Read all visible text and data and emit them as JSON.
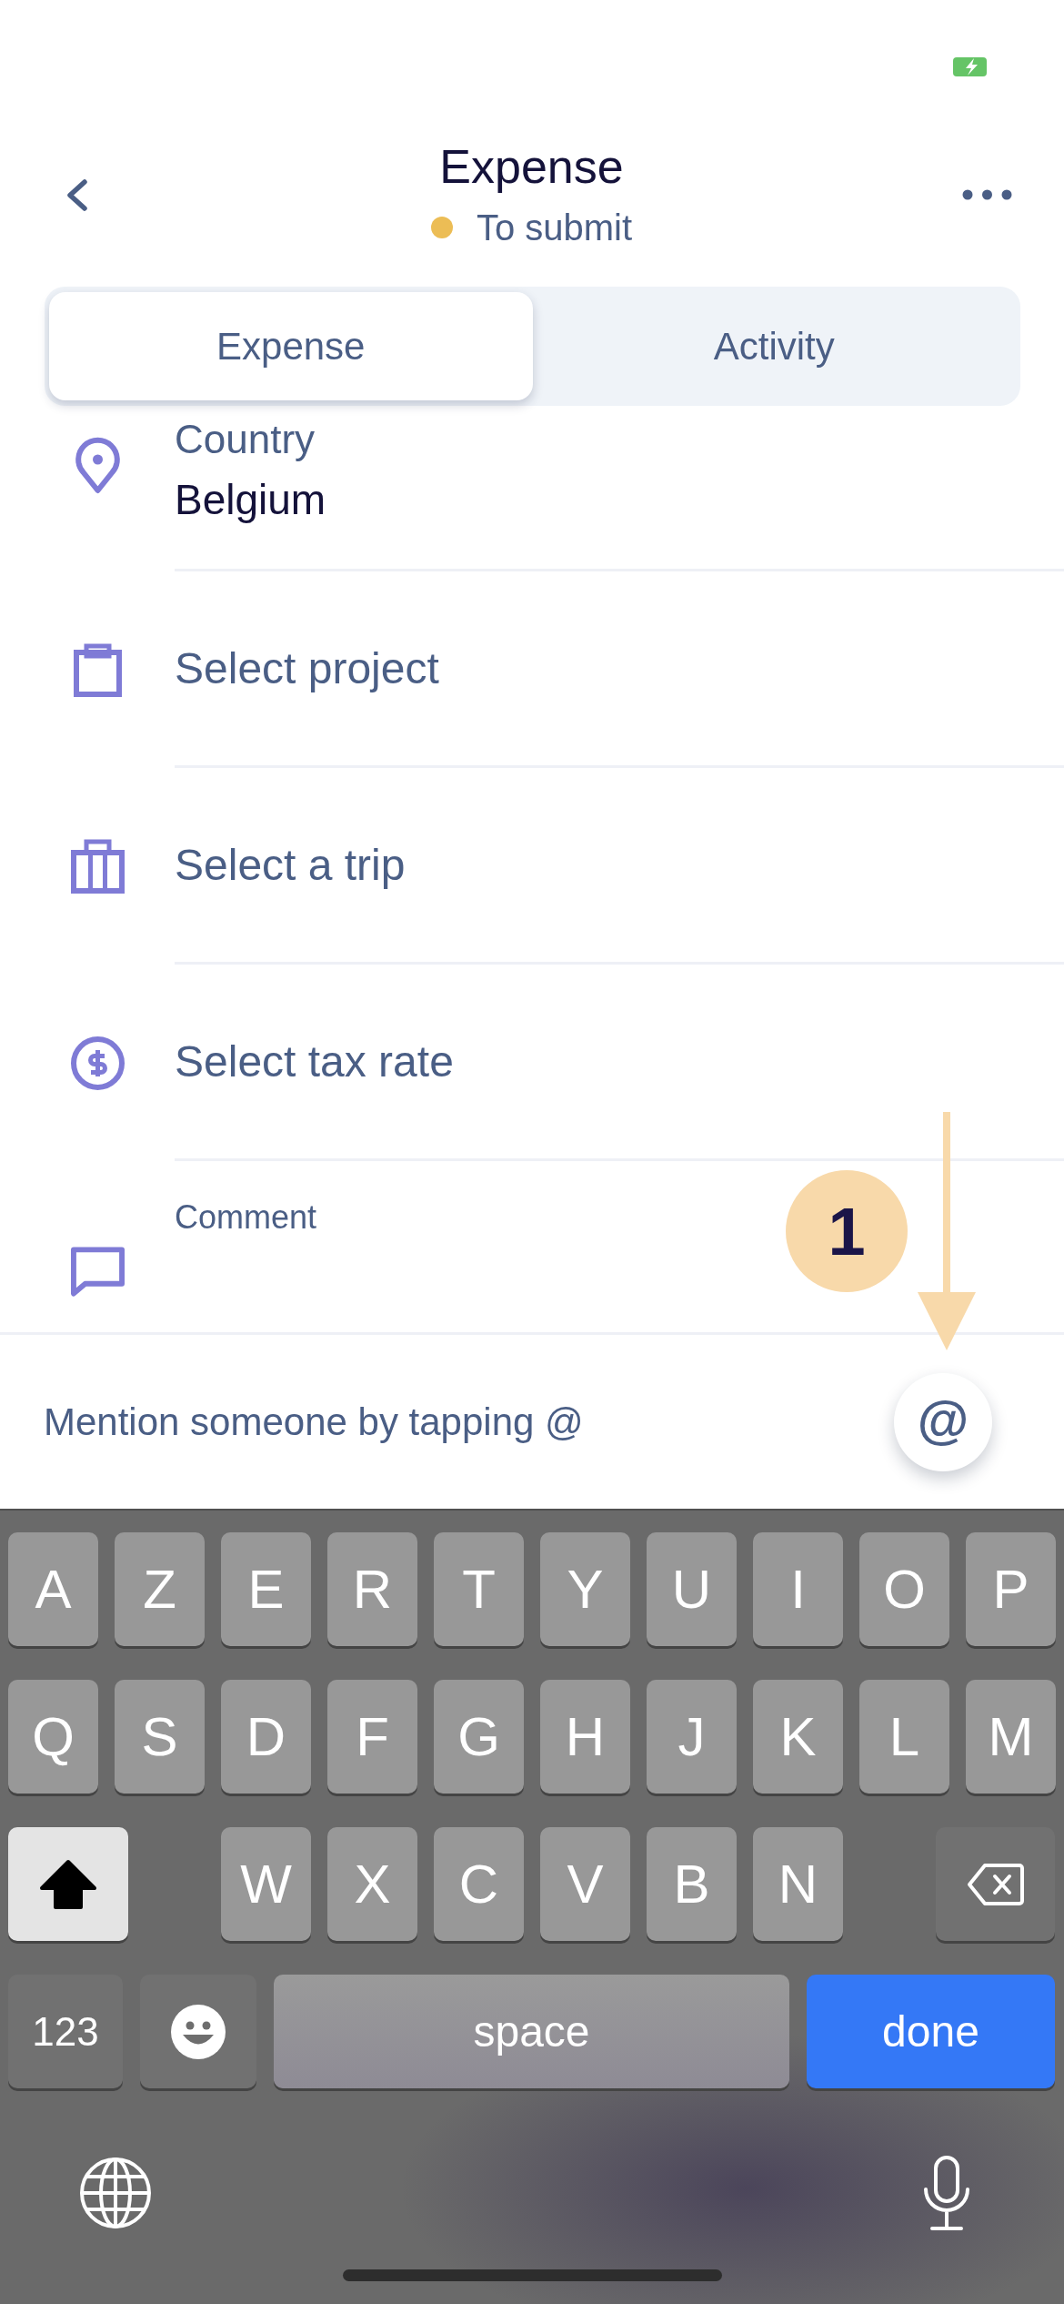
{
  "header": {
    "title": "Expense",
    "status": "To submit"
  },
  "tabs": [
    {
      "label": "Expense",
      "selected": true
    },
    {
      "label": "Activity",
      "selected": false
    }
  ],
  "fields": [
    {
      "kind": "value",
      "label": "Country",
      "value": "Belgium"
    },
    {
      "kind": "picker",
      "label": "Select project"
    },
    {
      "kind": "picker",
      "label": "Select a trip"
    },
    {
      "kind": "picker",
      "label": "Select tax rate"
    },
    {
      "kind": "comment",
      "label": "Comment"
    }
  ],
  "mention_bar": {
    "hint": "Mention someone by tapping @",
    "button": "@"
  },
  "callout": {
    "label": "1"
  },
  "keyboard": {
    "top_row": [
      "A",
      "Z",
      "E",
      "R",
      "T",
      "Y",
      "U",
      "I",
      "O",
      "P"
    ],
    "middle_row": [
      "Q",
      "S",
      "D",
      "F",
      "G",
      "H",
      "J",
      "K",
      "L",
      "M"
    ],
    "bottom_row": [
      "W",
      "X",
      "C",
      "V",
      "B",
      "N"
    ],
    "shift_on": true,
    "numbers_key": "123",
    "space_key": "space",
    "return_key": "done"
  }
}
